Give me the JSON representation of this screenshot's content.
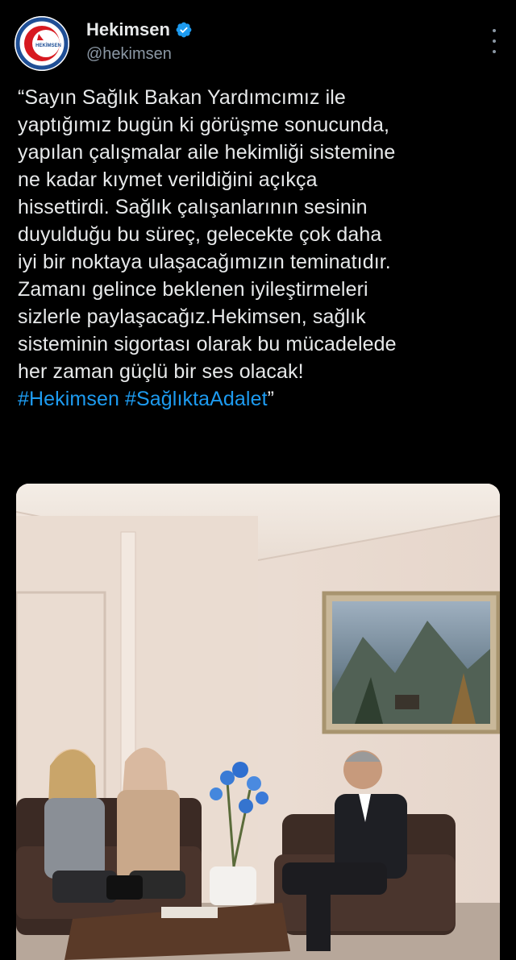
{
  "author": {
    "display_name": "Hekimsen",
    "handle": "@hekimsen",
    "verified_icon": "verified-badge-icon",
    "avatar_text": "HEKİMSEN"
  },
  "tweet": {
    "text_lines": [
      "“Sayın Sağlık Bakan Yardımcımız ile",
      "yaptığımız bugün ki görüşme sonucunda,",
      "yapılan çalışmalar aile hekimliği sistemine",
      "ne kadar kıymet verildiğini açıkça",
      "hissettirdi. Sağlık çalışanlarının sesinin",
      "duyulduğu bu süreç, gelecekte çok daha",
      "iyi bir noktaya ulaşacağımızın teminatıdır.",
      "Zamanı gelince beklenen iyileştirmeleri",
      "sizlerle paylaşacağız.Hekimsen, sağlık",
      "sisteminin sigortası olarak bu mücadelede",
      "her zaman güçlü bir ses olacak!"
    ],
    "hashtag_1": "#Hekimsen",
    "hashtag_2": "#SağlıktaAdalet",
    "closing_quote": "”"
  },
  "colors": {
    "background": "#000000",
    "text": "#e7e9ea",
    "secondary": "#8b98a5",
    "link": "#1d9bf0",
    "verified": "#1d9bf0"
  }
}
